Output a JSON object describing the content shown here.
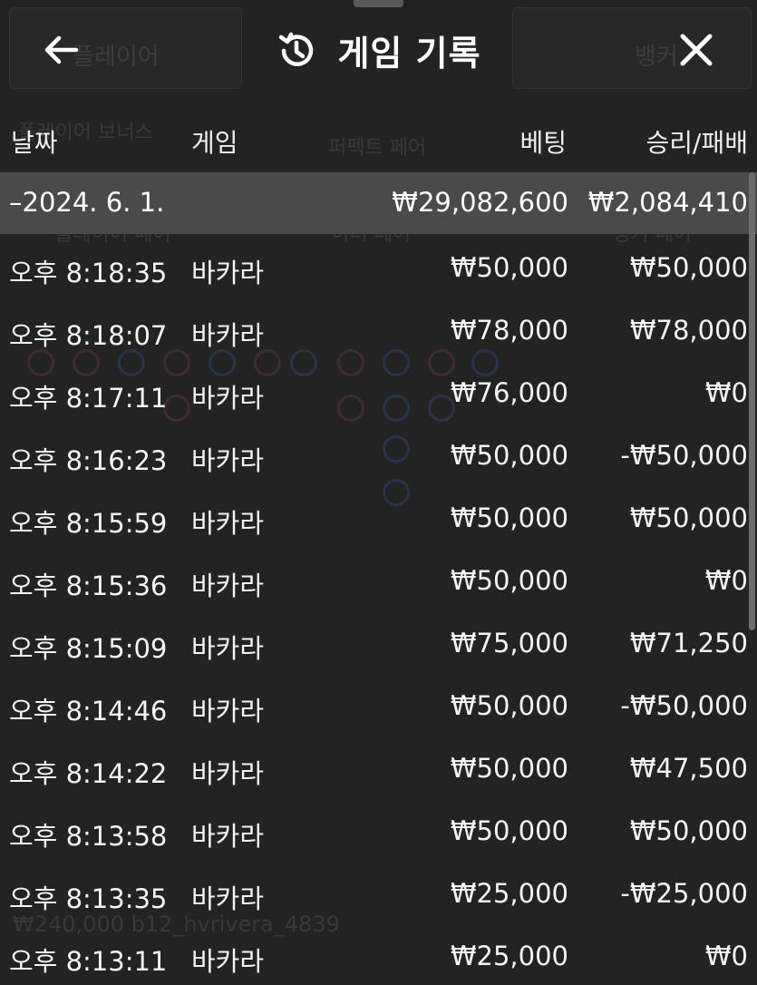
{
  "header": {
    "title": "게임 기록",
    "back_icon": "arrow-left-icon",
    "history_icon": "history-clock-icon",
    "close_icon": "close-icon"
  },
  "columns": {
    "date": "날짜",
    "game": "게임",
    "bet": "베팅",
    "result": "승리/패배"
  },
  "group": {
    "date": "–2024. 6. 1.",
    "bet_total": "₩29,082,600",
    "result_total": "₩2,084,410"
  },
  "rows": [
    {
      "time": "오후 8:18:35",
      "game": "바카라",
      "bet": "₩50,000",
      "result": "₩50,000"
    },
    {
      "time": "오후 8:18:07",
      "game": "바카라",
      "bet": "₩78,000",
      "result": "₩78,000"
    },
    {
      "time": "오후 8:17:11",
      "game": "바카라",
      "bet": "₩76,000",
      "result": "₩0"
    },
    {
      "time": "오후 8:16:23",
      "game": "바카라",
      "bet": "₩50,000",
      "result": "-₩50,000"
    },
    {
      "time": "오후 8:15:59",
      "game": "바카라",
      "bet": "₩50,000",
      "result": "₩50,000"
    },
    {
      "time": "오후 8:15:36",
      "game": "바카라",
      "bet": "₩50,000",
      "result": "₩0"
    },
    {
      "time": "오후 8:15:09",
      "game": "바카라",
      "bet": "₩75,000",
      "result": "₩71,250"
    },
    {
      "time": "오후 8:14:46",
      "game": "바카라",
      "bet": "₩50,000",
      "result": "-₩50,000"
    },
    {
      "time": "오후 8:14:22",
      "game": "바카라",
      "bet": "₩50,000",
      "result": "₩47,500"
    },
    {
      "time": "오후 8:13:58",
      "game": "바카라",
      "bet": "₩50,000",
      "result": "₩50,000"
    },
    {
      "time": "오후 8:13:35",
      "game": "바카라",
      "bet": "₩25,000",
      "result": "-₩25,000"
    },
    {
      "time": "오후 8:13:11",
      "game": "바카라",
      "bet": "₩25,000",
      "result": "₩0"
    }
  ],
  "background_ghost": {
    "player": "플레이어",
    "banker": "뱅커",
    "player_bonus": "플레이어 보너스",
    "perfect_pair": "퍼펙트 페어",
    "player_pair": "플레이어 페어",
    "either_pair": "이더 페어",
    "banker_pair": "뱅커 페어",
    "bottom_text": "₩240,000 b12_hvrivera_4839"
  },
  "colors": {
    "background": "#232323",
    "group_row": "#4a4a4a",
    "text": "#f2f2f2"
  }
}
